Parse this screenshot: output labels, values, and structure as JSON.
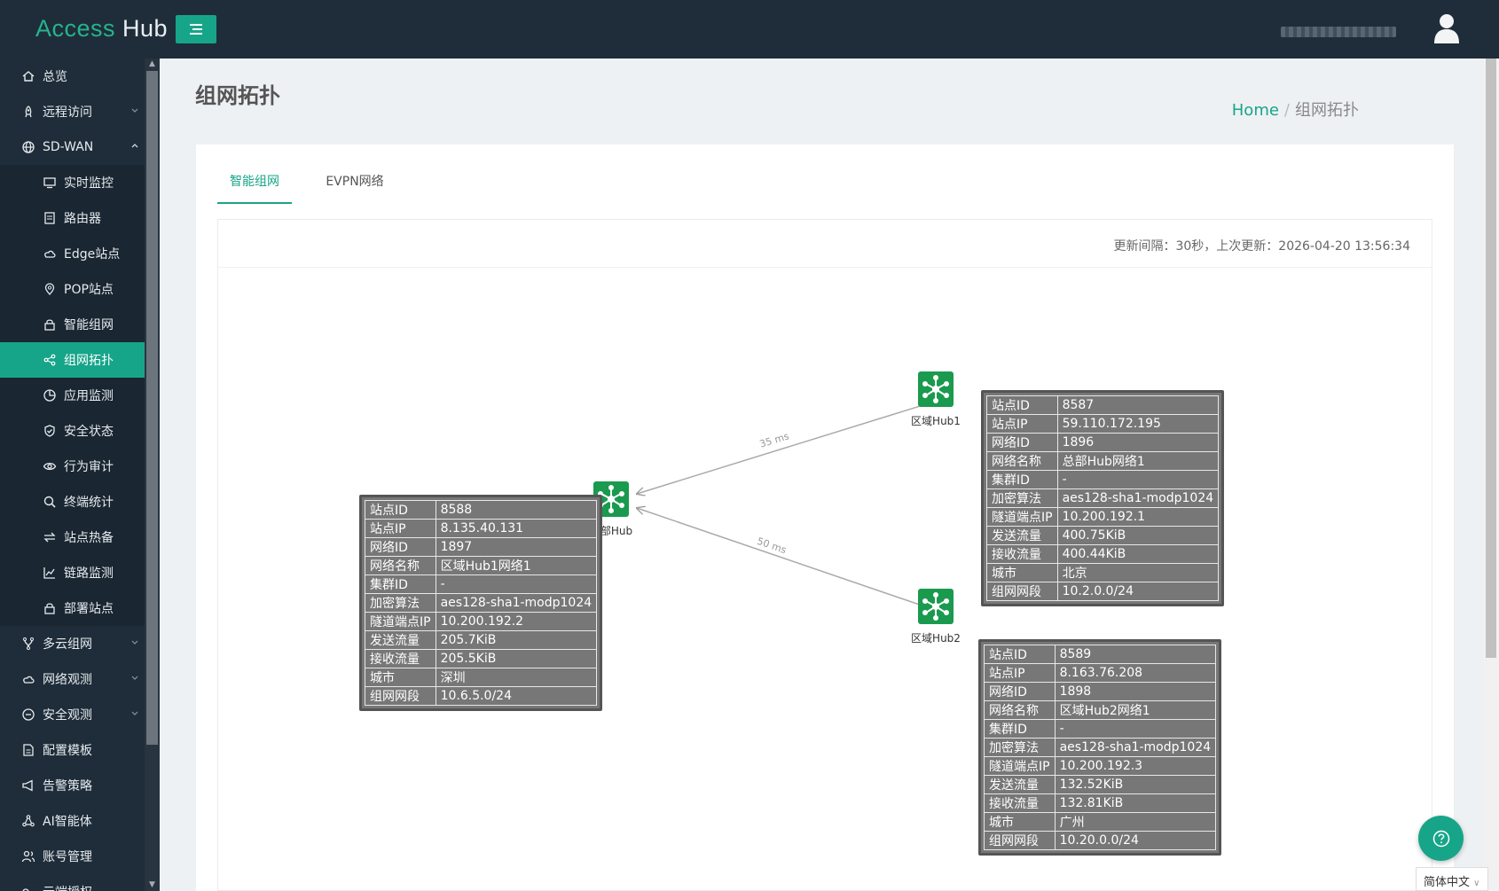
{
  "app": {
    "brand_access": "Access",
    "brand_hub": "Hub"
  },
  "sidebar": {
    "items": [
      {
        "label": "总览",
        "icon": "home-icon"
      },
      {
        "label": "远程访问",
        "icon": "rocket-icon",
        "expandable": true
      },
      {
        "label": "SD-WAN",
        "icon": "globe-icon",
        "expandable": true,
        "expanded": true
      }
    ],
    "sdwan_children": [
      {
        "label": "实时监控",
        "icon": "monitor-icon"
      },
      {
        "label": "路由器",
        "icon": "router-icon"
      },
      {
        "label": "Edge站点",
        "icon": "cloud-icon"
      },
      {
        "label": "POP站点",
        "icon": "location-pin-icon"
      },
      {
        "label": "智能组网",
        "icon": "lock-icon"
      },
      {
        "label": "组网拓扑",
        "icon": "share-icon",
        "active": true
      },
      {
        "label": "应用监测",
        "icon": "pie-chart-icon"
      },
      {
        "label": "安全状态",
        "icon": "shield-check-icon"
      },
      {
        "label": "行为审计",
        "icon": "eye-icon"
      },
      {
        "label": "终端统计",
        "icon": "search-icon"
      },
      {
        "label": "站点热备",
        "icon": "swap-icon"
      },
      {
        "label": "链路监测",
        "icon": "line-chart-icon"
      },
      {
        "label": "部署站点",
        "icon": "lock-icon"
      }
    ],
    "bottom_items": [
      {
        "label": "多云组网",
        "icon": "fork-icon",
        "expandable": true
      },
      {
        "label": "网络观测",
        "icon": "cloud-icon",
        "expandable": true
      },
      {
        "label": "安全观测",
        "icon": "minus-circle-icon",
        "expandable": true
      },
      {
        "label": "配置模板",
        "icon": "file-icon"
      },
      {
        "label": "告警策略",
        "icon": "megaphone-icon"
      },
      {
        "label": "AI智能体",
        "icon": "cluster-icon"
      },
      {
        "label": "账号管理",
        "icon": "user-group-icon"
      },
      {
        "label": "云端授权",
        "icon": "key-icon"
      }
    ]
  },
  "page": {
    "title": "组网拓扑",
    "breadcrumb_home": "Home",
    "breadcrumb_current": "组网拓扑"
  },
  "tabs": [
    {
      "label": "智能组网",
      "active": true
    },
    {
      "label": "EVPN网络",
      "active": false
    }
  ],
  "update_info": "更新间隔：30秒，上次更新：2026-04-20 13:56:34",
  "topology": {
    "nodes": {
      "hq": {
        "label": "总部Hub"
      },
      "hub1": {
        "label": "区域Hub1"
      },
      "hub2": {
        "label": "区域Hub2"
      }
    },
    "links": {
      "hub1_hq": "35 ms",
      "hub2_hq": "50 ms"
    },
    "info_keys": [
      "站点ID",
      "站点IP",
      "网络ID",
      "网络名称",
      "集群ID",
      "加密算法",
      "隧道端点IP",
      "发送流量",
      "接收流量",
      "城市",
      "组网网段"
    ],
    "hq_info": [
      "8588",
      "8.135.40.131",
      "1897",
      "区域Hub1网络1",
      "-",
      "aes128-sha1-modp1024",
      "10.200.192.2",
      "205.7KiB",
      "205.5KiB",
      "深圳",
      "10.6.5.0/24"
    ],
    "hub1_info": [
      "8587",
      "59.110.172.195",
      "1896",
      "总部Hub网络1",
      "-",
      "aes128-sha1-modp1024",
      "10.200.192.1",
      "400.75KiB",
      "400.44KiB",
      "北京",
      "10.2.0.0/24"
    ],
    "hub2_info": [
      "8589",
      "8.163.76.208",
      "1898",
      "区域Hub2网络1",
      "-",
      "aes128-sha1-modp1024",
      "10.200.192.3",
      "132.52KiB",
      "132.81KiB",
      "广州",
      "10.20.0.0/24"
    ]
  },
  "language": "简体中文"
}
